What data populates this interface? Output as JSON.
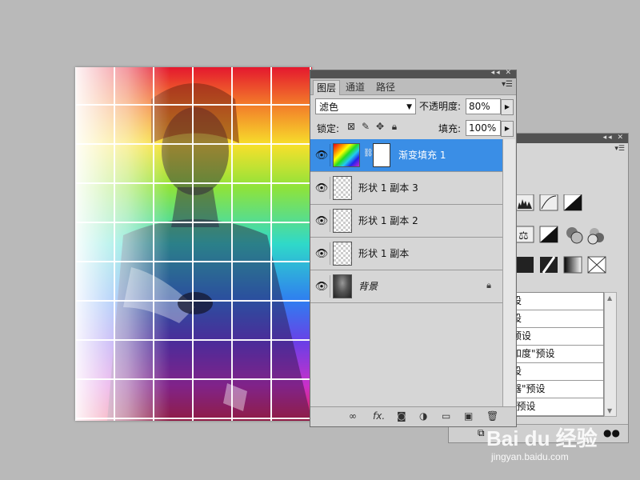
{
  "canvas": {
    "description_colors": [
      "#e4182e",
      "#f7e02b",
      "#2fd9c9",
      "#2f7ef0",
      "#c930c9"
    ]
  },
  "layers_panel": {
    "tabs": [
      {
        "label": "图层",
        "active": true
      },
      {
        "label": "通道",
        "active": false
      },
      {
        "label": "路径",
        "active": false
      }
    ],
    "blend_mode": "滤色",
    "opacity_label": "不透明度:",
    "opacity_value": "80%",
    "lock_label": "锁定:",
    "fill_label": "填充:",
    "fill_value": "100%",
    "layers": [
      {
        "name": "渐变填充 1",
        "selected": true,
        "type": "gradient-fill"
      },
      {
        "name": "形状 1 副本 3",
        "selected": false,
        "type": "shape"
      },
      {
        "name": "形状 1 副本 2",
        "selected": false,
        "type": "shape"
      },
      {
        "name": "形状 1 副本",
        "selected": false,
        "type": "shape"
      },
      {
        "name": "背景",
        "selected": false,
        "type": "background"
      }
    ],
    "bottom_icons": [
      "link-icon",
      "fx-icon",
      "mask-icon",
      "adjustment-icon",
      "folder-icon",
      "new-layer-icon",
      "trash-icon"
    ],
    "bottom_fx_label": "fx."
  },
  "adjustments_panel": {
    "preset_items": [
      "设",
      "设",
      "预设",
      "和度\"预设",
      "设",
      "器\"预设",
      "\"预设"
    ]
  },
  "watermark": {
    "brand": "Bai du 经验",
    "url": "jingyan.baidu.com"
  },
  "colors": {
    "selection": "#3a8ee6",
    "panel_bg": "#d6d6d6",
    "titlebar": "#525252",
    "workspace": "#b9b9b9"
  }
}
